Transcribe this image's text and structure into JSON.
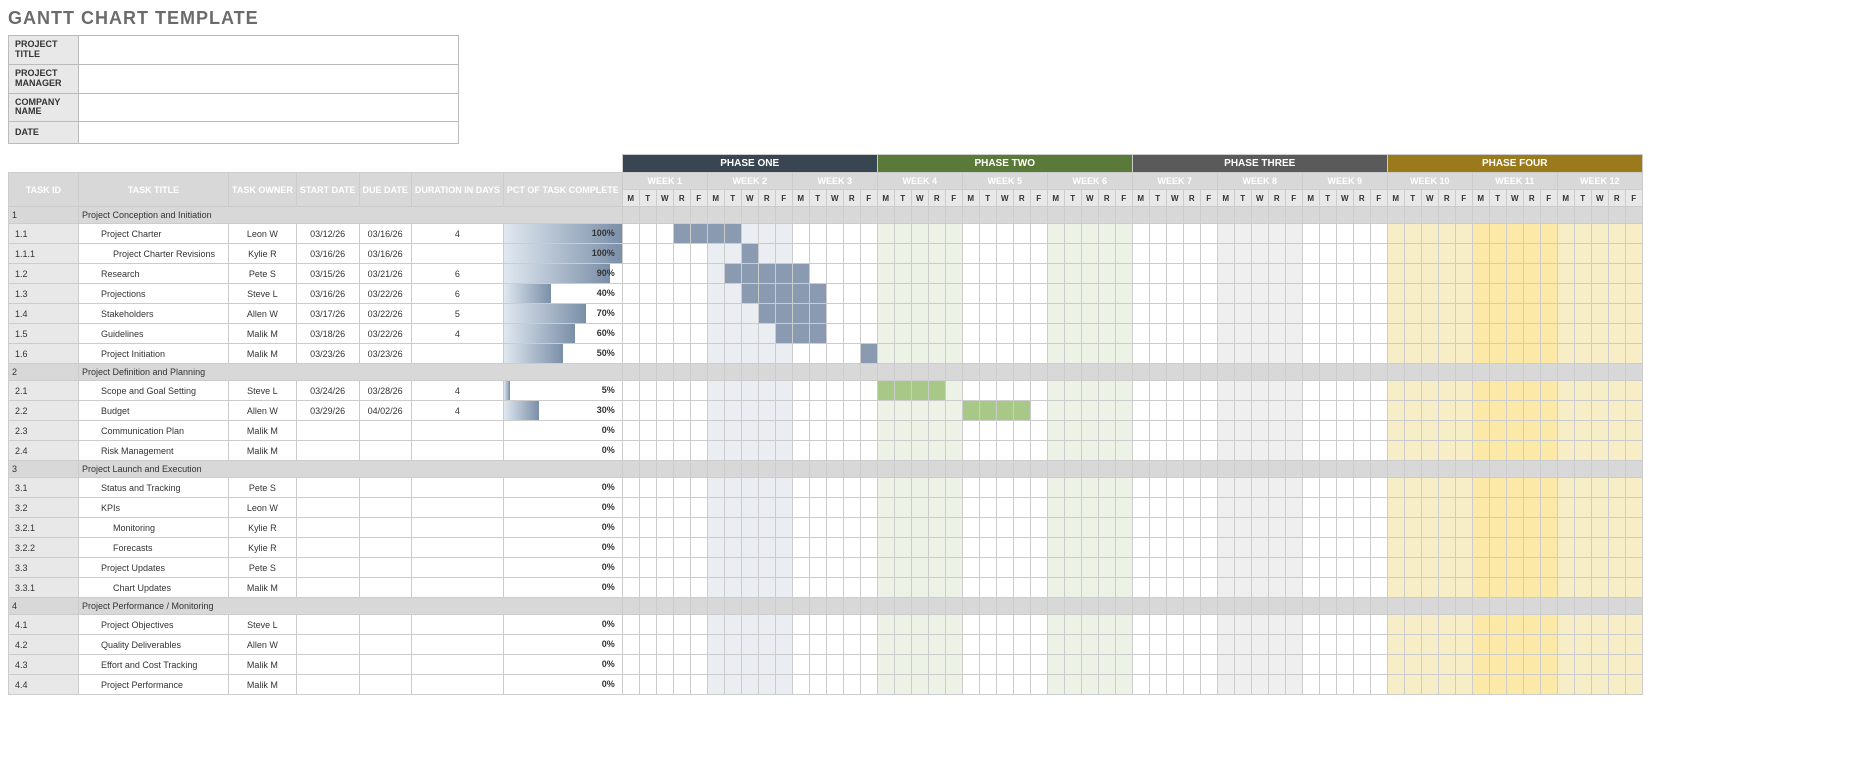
{
  "title": "GANTT CHART TEMPLATE",
  "info_labels": [
    "PROJECT TITLE",
    "PROJECT MANAGER",
    "COMPANY NAME",
    "DATE"
  ],
  "columns": [
    "TASK ID",
    "TASK TITLE",
    "TASK OWNER",
    "START DATE",
    "DUE DATE",
    "DURATION IN DAYS",
    "PCT OF TASK COMPLETE"
  ],
  "phases": [
    {
      "name": "PHASE ONE",
      "cls": "ph1",
      "wkcls": "wk1",
      "weeks": [
        "WEEK 1",
        "WEEK 2",
        "WEEK 3"
      ]
    },
    {
      "name": "PHASE TWO",
      "cls": "ph2",
      "wkcls": "wk2",
      "weeks": [
        "WEEK 4",
        "WEEK 5",
        "WEEK 6"
      ]
    },
    {
      "name": "PHASE THREE",
      "cls": "ph3",
      "wkcls": "wk3",
      "weeks": [
        "WEEK 7",
        "WEEK 8",
        "WEEK 9"
      ]
    },
    {
      "name": "PHASE FOUR",
      "cls": "ph4",
      "wkcls": "wk4",
      "weeks": [
        "WEEK 10",
        "WEEK 11",
        "WEEK 12"
      ]
    }
  ],
  "days": [
    "M",
    "T",
    "W",
    "R",
    "F"
  ],
  "rows": [
    {
      "id": "1",
      "title": "Project Conception and Initiation",
      "section": true
    },
    {
      "id": "1.1",
      "title": "Project Charter",
      "owner": "Leon W",
      "start": "03/12/26",
      "due": "03/16/26",
      "dur": "4",
      "pct": 100,
      "indent": 1,
      "bar": [
        3,
        6,
        "blue"
      ]
    },
    {
      "id": "1.1.1",
      "title": "Project Charter Revisions",
      "owner": "Kylie R",
      "start": "03/16/26",
      "due": "03/16/26",
      "dur": "",
      "pct": 100,
      "indent": 2,
      "bar": [
        7,
        7,
        "blue"
      ]
    },
    {
      "id": "1.2",
      "title": "Research",
      "owner": "Pete S",
      "start": "03/15/26",
      "due": "03/21/26",
      "dur": "6",
      "pct": 90,
      "indent": 1,
      "bar": [
        6,
        10,
        "blue"
      ]
    },
    {
      "id": "1.3",
      "title": "Projections",
      "owner": "Steve L",
      "start": "03/16/26",
      "due": "03/22/26",
      "dur": "6",
      "pct": 40,
      "indent": 1,
      "bar": [
        7,
        11,
        "blue"
      ]
    },
    {
      "id": "1.4",
      "title": "Stakeholders",
      "owner": "Allen W",
      "start": "03/17/26",
      "due": "03/22/26",
      "dur": "5",
      "pct": 70,
      "indent": 1,
      "bar": [
        8,
        11,
        "blue"
      ]
    },
    {
      "id": "1.5",
      "title": "Guidelines",
      "owner": "Malik M",
      "start": "03/18/26",
      "due": "03/22/26",
      "dur": "4",
      "pct": 60,
      "indent": 1,
      "bar": [
        9,
        11,
        "blue"
      ]
    },
    {
      "id": "1.6",
      "title": "Project Initiation",
      "owner": "Malik M",
      "start": "03/23/26",
      "due": "03/23/26",
      "dur": "",
      "pct": 50,
      "indent": 1,
      "bar": [
        14,
        14,
        "blue"
      ]
    },
    {
      "id": "2",
      "title": "Project Definition and Planning",
      "section": true
    },
    {
      "id": "2.1",
      "title": "Scope and Goal Setting",
      "owner": "Steve L",
      "start": "03/24/26",
      "due": "03/28/26",
      "dur": "4",
      "pct": 5,
      "indent": 1,
      "bar": [
        15,
        18,
        "green"
      ]
    },
    {
      "id": "2.2",
      "title": "Budget",
      "owner": "Allen W",
      "start": "03/29/26",
      "due": "04/02/26",
      "dur": "4",
      "pct": 30,
      "indent": 1,
      "bar": [
        20,
        23,
        "green"
      ]
    },
    {
      "id": "2.3",
      "title": "Communication Plan",
      "owner": "Malik M",
      "start": "",
      "due": "",
      "dur": "",
      "pct": 0,
      "indent": 1
    },
    {
      "id": "2.4",
      "title": "Risk Management",
      "owner": "Malik M",
      "start": "",
      "due": "",
      "dur": "",
      "pct": 0,
      "indent": 1
    },
    {
      "id": "3",
      "title": "Project Launch and Execution",
      "section": true
    },
    {
      "id": "3.1",
      "title": "Status and Tracking",
      "owner": "Pete S",
      "start": "",
      "due": "",
      "dur": "",
      "pct": 0,
      "indent": 1
    },
    {
      "id": "3.2",
      "title": "KPIs",
      "owner": "Leon W",
      "start": "",
      "due": "",
      "dur": "",
      "pct": 0,
      "indent": 1
    },
    {
      "id": "3.2.1",
      "title": "Monitoring",
      "owner": "Kylie R",
      "start": "",
      "due": "",
      "dur": "",
      "pct": 0,
      "indent": 2
    },
    {
      "id": "3.2.2",
      "title": "Forecasts",
      "owner": "Kylie R",
      "start": "",
      "due": "",
      "dur": "",
      "pct": 0,
      "indent": 2
    },
    {
      "id": "3.3",
      "title": "Project Updates",
      "owner": "Pete S",
      "start": "",
      "due": "",
      "dur": "",
      "pct": 0,
      "indent": 1
    },
    {
      "id": "3.3.1",
      "title": "Chart Updates",
      "owner": "Malik M",
      "start": "",
      "due": "",
      "dur": "",
      "pct": 0,
      "indent": 2
    },
    {
      "id": "4",
      "title": "Project Performance / Monitoring",
      "section": true
    },
    {
      "id": "4.1",
      "title": "Project Objectives",
      "owner": "Steve L",
      "start": "",
      "due": "",
      "dur": "",
      "pct": 0,
      "indent": 1
    },
    {
      "id": "4.2",
      "title": "Quality Deliverables",
      "owner": "Allen W",
      "start": "",
      "due": "",
      "dur": "",
      "pct": 0,
      "indent": 1
    },
    {
      "id": "4.3",
      "title": "Effort and Cost Tracking",
      "owner": "Malik M",
      "start": "",
      "due": "",
      "dur": "",
      "pct": 0,
      "indent": 1
    },
    {
      "id": "4.4",
      "title": "Project Performance",
      "owner": "Malik M",
      "start": "",
      "due": "",
      "dur": "",
      "pct": 0,
      "indent": 1
    }
  ],
  "chart_data": {
    "type": "table",
    "title": "GANTT CHART TEMPLATE",
    "timeline": {
      "weeks": 12,
      "days_per_week": 5,
      "day_labels": [
        "M",
        "T",
        "W",
        "R",
        "F"
      ]
    },
    "tasks": [
      {
        "id": "1.1",
        "title": "Project Charter",
        "owner": "Leon W",
        "start": "03/12/26",
        "due": "03/16/26",
        "duration_days": 4,
        "pct_complete": 100,
        "bar_days": [
          3,
          6
        ]
      },
      {
        "id": "1.1.1",
        "title": "Project Charter Revisions",
        "owner": "Kylie R",
        "start": "03/16/26",
        "due": "03/16/26",
        "duration_days": null,
        "pct_complete": 100,
        "bar_days": [
          7,
          7
        ]
      },
      {
        "id": "1.2",
        "title": "Research",
        "owner": "Pete S",
        "start": "03/15/26",
        "due": "03/21/26",
        "duration_days": 6,
        "pct_complete": 90,
        "bar_days": [
          6,
          10
        ]
      },
      {
        "id": "1.3",
        "title": "Projections",
        "owner": "Steve L",
        "start": "03/16/26",
        "due": "03/22/26",
        "duration_days": 6,
        "pct_complete": 40,
        "bar_days": [
          7,
          11
        ]
      },
      {
        "id": "1.4",
        "title": "Stakeholders",
        "owner": "Allen W",
        "start": "03/17/26",
        "due": "03/22/26",
        "duration_days": 5,
        "pct_complete": 70,
        "bar_days": [
          8,
          11
        ]
      },
      {
        "id": "1.5",
        "title": "Guidelines",
        "owner": "Malik M",
        "start": "03/18/26",
        "due": "03/22/26",
        "duration_days": 4,
        "pct_complete": 60,
        "bar_days": [
          9,
          11
        ]
      },
      {
        "id": "1.6",
        "title": "Project Initiation",
        "owner": "Malik M",
        "start": "03/23/26",
        "due": "03/23/26",
        "duration_days": null,
        "pct_complete": 50,
        "bar_days": [
          14,
          14
        ]
      },
      {
        "id": "2.1",
        "title": "Scope and Goal Setting",
        "owner": "Steve L",
        "start": "03/24/26",
        "due": "03/28/26",
        "duration_days": 4,
        "pct_complete": 5,
        "bar_days": [
          15,
          18
        ]
      },
      {
        "id": "2.2",
        "title": "Budget",
        "owner": "Allen W",
        "start": "03/29/26",
        "due": "04/02/26",
        "duration_days": 4,
        "pct_complete": 30,
        "bar_days": [
          20,
          23
        ]
      },
      {
        "id": "2.3",
        "title": "Communication Plan",
        "owner": "Malik M",
        "pct_complete": 0
      },
      {
        "id": "2.4",
        "title": "Risk Management",
        "owner": "Malik M",
        "pct_complete": 0
      },
      {
        "id": "3.1",
        "title": "Status and Tracking",
        "owner": "Pete S",
        "pct_complete": 0
      },
      {
        "id": "3.2",
        "title": "KPIs",
        "owner": "Leon W",
        "pct_complete": 0
      },
      {
        "id": "3.2.1",
        "title": "Monitoring",
        "owner": "Kylie R",
        "pct_complete": 0
      },
      {
        "id": "3.2.2",
        "title": "Forecasts",
        "owner": "Kylie R",
        "pct_complete": 0
      },
      {
        "id": "3.3",
        "title": "Project Updates",
        "owner": "Pete S",
        "pct_complete": 0
      },
      {
        "id": "3.3.1",
        "title": "Chart Updates",
        "owner": "Malik M",
        "pct_complete": 0
      },
      {
        "id": "4.1",
        "title": "Project Objectives",
        "owner": "Steve L",
        "pct_complete": 0
      },
      {
        "id": "4.2",
        "title": "Quality Deliverables",
        "owner": "Allen W",
        "pct_complete": 0
      },
      {
        "id": "4.3",
        "title": "Effort and Cost Tracking",
        "owner": "Malik M",
        "pct_complete": 0
      },
      {
        "id": "4.4",
        "title": "Project Performance",
        "owner": "Malik M",
        "pct_complete": 0
      }
    ]
  }
}
